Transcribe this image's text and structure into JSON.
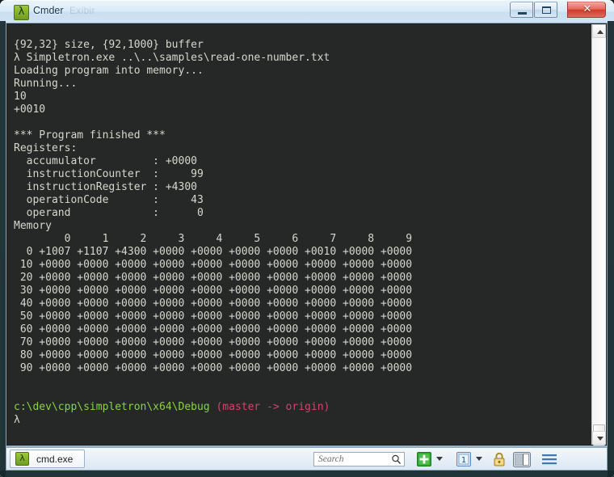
{
  "window": {
    "title": "Cmder",
    "ghost_title": "Exibir",
    "app_icon": "lambda-icon",
    "buttons": {
      "minimize": "minimize-icon",
      "maximize": "restore-icon",
      "close": "✕"
    }
  },
  "console": {
    "lines": [
      {
        "text": "{92,32} size, {92,1000} buffer"
      },
      {
        "text": "λ Simpletron.exe ..\\..\\samples\\read-one-number.txt"
      },
      {
        "text": "Loading program into memory..."
      },
      {
        "text": "Running..."
      },
      {
        "text": "10"
      },
      {
        "text": "+0010"
      },
      {
        "text": ""
      },
      {
        "text": "*** Program finished ***"
      },
      {
        "text": "Registers:"
      },
      {
        "text": "  accumulator         : +0000"
      },
      {
        "text": "  instructionCounter  :     99"
      },
      {
        "text": "  instructionRegister : +4300"
      },
      {
        "text": "  operationCode       :     43"
      },
      {
        "text": "  operand             :      0"
      },
      {
        "text": "Memory"
      }
    ],
    "memory": {
      "label": "Memory",
      "col_headers": [
        "0",
        "1",
        "2",
        "3",
        "4",
        "5",
        "6",
        "7",
        "8",
        "9"
      ],
      "rows": [
        {
          "label": "0",
          "cells": [
            "+1007",
            "+1107",
            "+4300",
            "+0000",
            "+0000",
            "+0000",
            "+0000",
            "+0010",
            "+0000",
            "+0000"
          ]
        },
        {
          "label": "10",
          "cells": [
            "+0000",
            "+0000",
            "+0000",
            "+0000",
            "+0000",
            "+0000",
            "+0000",
            "+0000",
            "+0000",
            "+0000"
          ]
        },
        {
          "label": "20",
          "cells": [
            "+0000",
            "+0000",
            "+0000",
            "+0000",
            "+0000",
            "+0000",
            "+0000",
            "+0000",
            "+0000",
            "+0000"
          ]
        },
        {
          "label": "30",
          "cells": [
            "+0000",
            "+0000",
            "+0000",
            "+0000",
            "+0000",
            "+0000",
            "+0000",
            "+0000",
            "+0000",
            "+0000"
          ]
        },
        {
          "label": "40",
          "cells": [
            "+0000",
            "+0000",
            "+0000",
            "+0000",
            "+0000",
            "+0000",
            "+0000",
            "+0000",
            "+0000",
            "+0000"
          ]
        },
        {
          "label": "50",
          "cells": [
            "+0000",
            "+0000",
            "+0000",
            "+0000",
            "+0000",
            "+0000",
            "+0000",
            "+0000",
            "+0000",
            "+0000"
          ]
        },
        {
          "label": "60",
          "cells": [
            "+0000",
            "+0000",
            "+0000",
            "+0000",
            "+0000",
            "+0000",
            "+0000",
            "+0000",
            "+0000",
            "+0000"
          ]
        },
        {
          "label": "70",
          "cells": [
            "+0000",
            "+0000",
            "+0000",
            "+0000",
            "+0000",
            "+0000",
            "+0000",
            "+0000",
            "+0000",
            "+0000"
          ]
        },
        {
          "label": "80",
          "cells": [
            "+0000",
            "+0000",
            "+0000",
            "+0000",
            "+0000",
            "+0000",
            "+0000",
            "+0000",
            "+0000",
            "+0000"
          ]
        },
        {
          "label": "90",
          "cells": [
            "+0000",
            "+0000",
            "+0000",
            "+0000",
            "+0000",
            "+0000",
            "+0000",
            "+0000",
            "+0000",
            "+0000"
          ]
        }
      ]
    },
    "prompt": {
      "path": "c:\\dev\\cpp\\simpletron\\x64\\Debug",
      "git": "(master -> origin)",
      "symbol": "λ"
    },
    "colors": {
      "background": "#252826",
      "text": "#d6d7ce",
      "path_green": "#87d441",
      "git_crimson": "#d3436e"
    }
  },
  "statusbar": {
    "tab": {
      "label": "cmd.exe",
      "icon": "lambda-icon"
    },
    "search": {
      "placeholder": "Search",
      "value": "",
      "icon": "search-icon"
    },
    "tools": [
      {
        "name": "new-console-button",
        "icon": "plus-icon"
      },
      {
        "name": "new-console-dropdown",
        "icon": "chevron-down-icon"
      },
      {
        "name": "active-console-button",
        "icon": "one-icon",
        "label": "1"
      },
      {
        "name": "active-console-dropdown",
        "icon": "chevron-down-icon"
      },
      {
        "name": "lock-button",
        "icon": "lock-icon"
      },
      {
        "name": "split-pane-button",
        "icon": "split-pane-icon"
      },
      {
        "name": "menu-button",
        "icon": "hamburger-menu-icon"
      }
    ]
  }
}
